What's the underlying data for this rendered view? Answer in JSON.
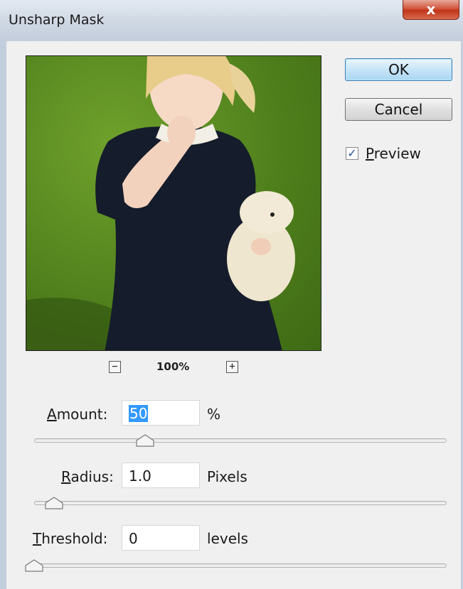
{
  "window": {
    "title": "Unsharp Mask",
    "close_label": "x"
  },
  "preview": {
    "zoom_level": "100%",
    "zoom_out_label": "−",
    "zoom_in_label": "+"
  },
  "buttons": {
    "ok_label": "OK",
    "cancel_label": "Cancel"
  },
  "preview_toggle": {
    "checked": true,
    "label_underlined": "P",
    "label_rest": "review"
  },
  "params": {
    "amount": {
      "label_underlined": "A",
      "label_rest": "mount:",
      "value": "50",
      "unit": "%",
      "slider_fraction": 0.27
    },
    "radius": {
      "label_underlined": "R",
      "label_rest": "adius:",
      "value": "1.0",
      "unit": "Pixels",
      "slider_fraction": 0.05
    },
    "threshold": {
      "label_underlined": "T",
      "label_rest": "hreshold:",
      "value": "0",
      "unit": "levels",
      "slider_fraction": 0.0
    }
  },
  "icons": {
    "close": "close-icon",
    "zoom_out": "minus-icon",
    "zoom_in": "plus-icon",
    "check": "checkmark-icon"
  }
}
